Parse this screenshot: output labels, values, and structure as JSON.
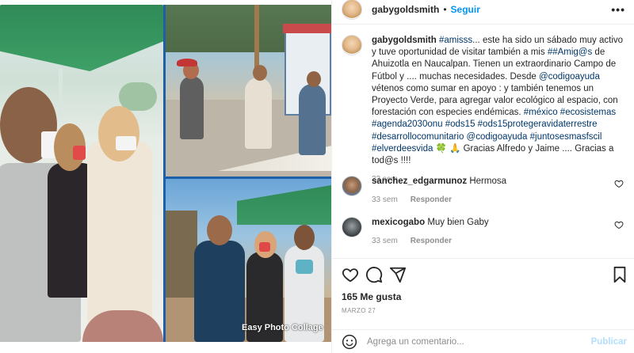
{
  "post": {
    "username": "gabygoldsmith",
    "dot": "•",
    "follow_label": "Seguir",
    "more_label": "•••",
    "watermark": "Easy Photo Collage",
    "caption": {
      "username": "gabygoldsmith",
      "t1": "#amisss",
      "t2": "... este ha sido un sábado muy activo y tuve oportunidad de visitar también a mis ",
      "t3": "##Amig@s",
      "t4": " de Ahuizotla en Naucalpan. Tienen un extraordinario Campo de Fútbol y .... muchas necesidades. Desde ",
      "t5": "@codigoayuda",
      "t6": " vétenos como sumar en apoyo : y también tenemos un Proyecto Verde, para agregar valor ecológico al espacio, con forestación con especies endémicas. ",
      "t7": "#méxico #ecosistemas #agenda2030onu #ods15 #ods15protegeravidaterrestre #desarrollocomunitario @codigoayuda #juntosesmasfscil #elverdeesvida",
      "t8": " 🍀 🙏 Gracias Alfredo y Jaime .... Gracias a tod@s !!!!",
      "time": "33 sem"
    },
    "comments": [
      {
        "username": "sanchez_edgarmunoz",
        "text": "Hermosa",
        "time": "33 sem",
        "reply": "Responder"
      },
      {
        "username": "mexicogabo",
        "text": "Muy bien Gaby",
        "time": "33 sem",
        "reply": "Responder"
      }
    ],
    "likes": "165 Me gusta",
    "date": "MARZO 27",
    "add_comment_placeholder": "Agrega un comentario...",
    "publish_label": "Publicar"
  },
  "icons": [
    "heart-icon",
    "comment-icon",
    "share-icon",
    "bookmark-icon",
    "emoji-icon",
    "more-icon"
  ],
  "colors": {
    "link": "#00376b",
    "follow": "#0095f6",
    "muted": "#8e8e8e",
    "publish_disabled": "#b2dffc"
  }
}
